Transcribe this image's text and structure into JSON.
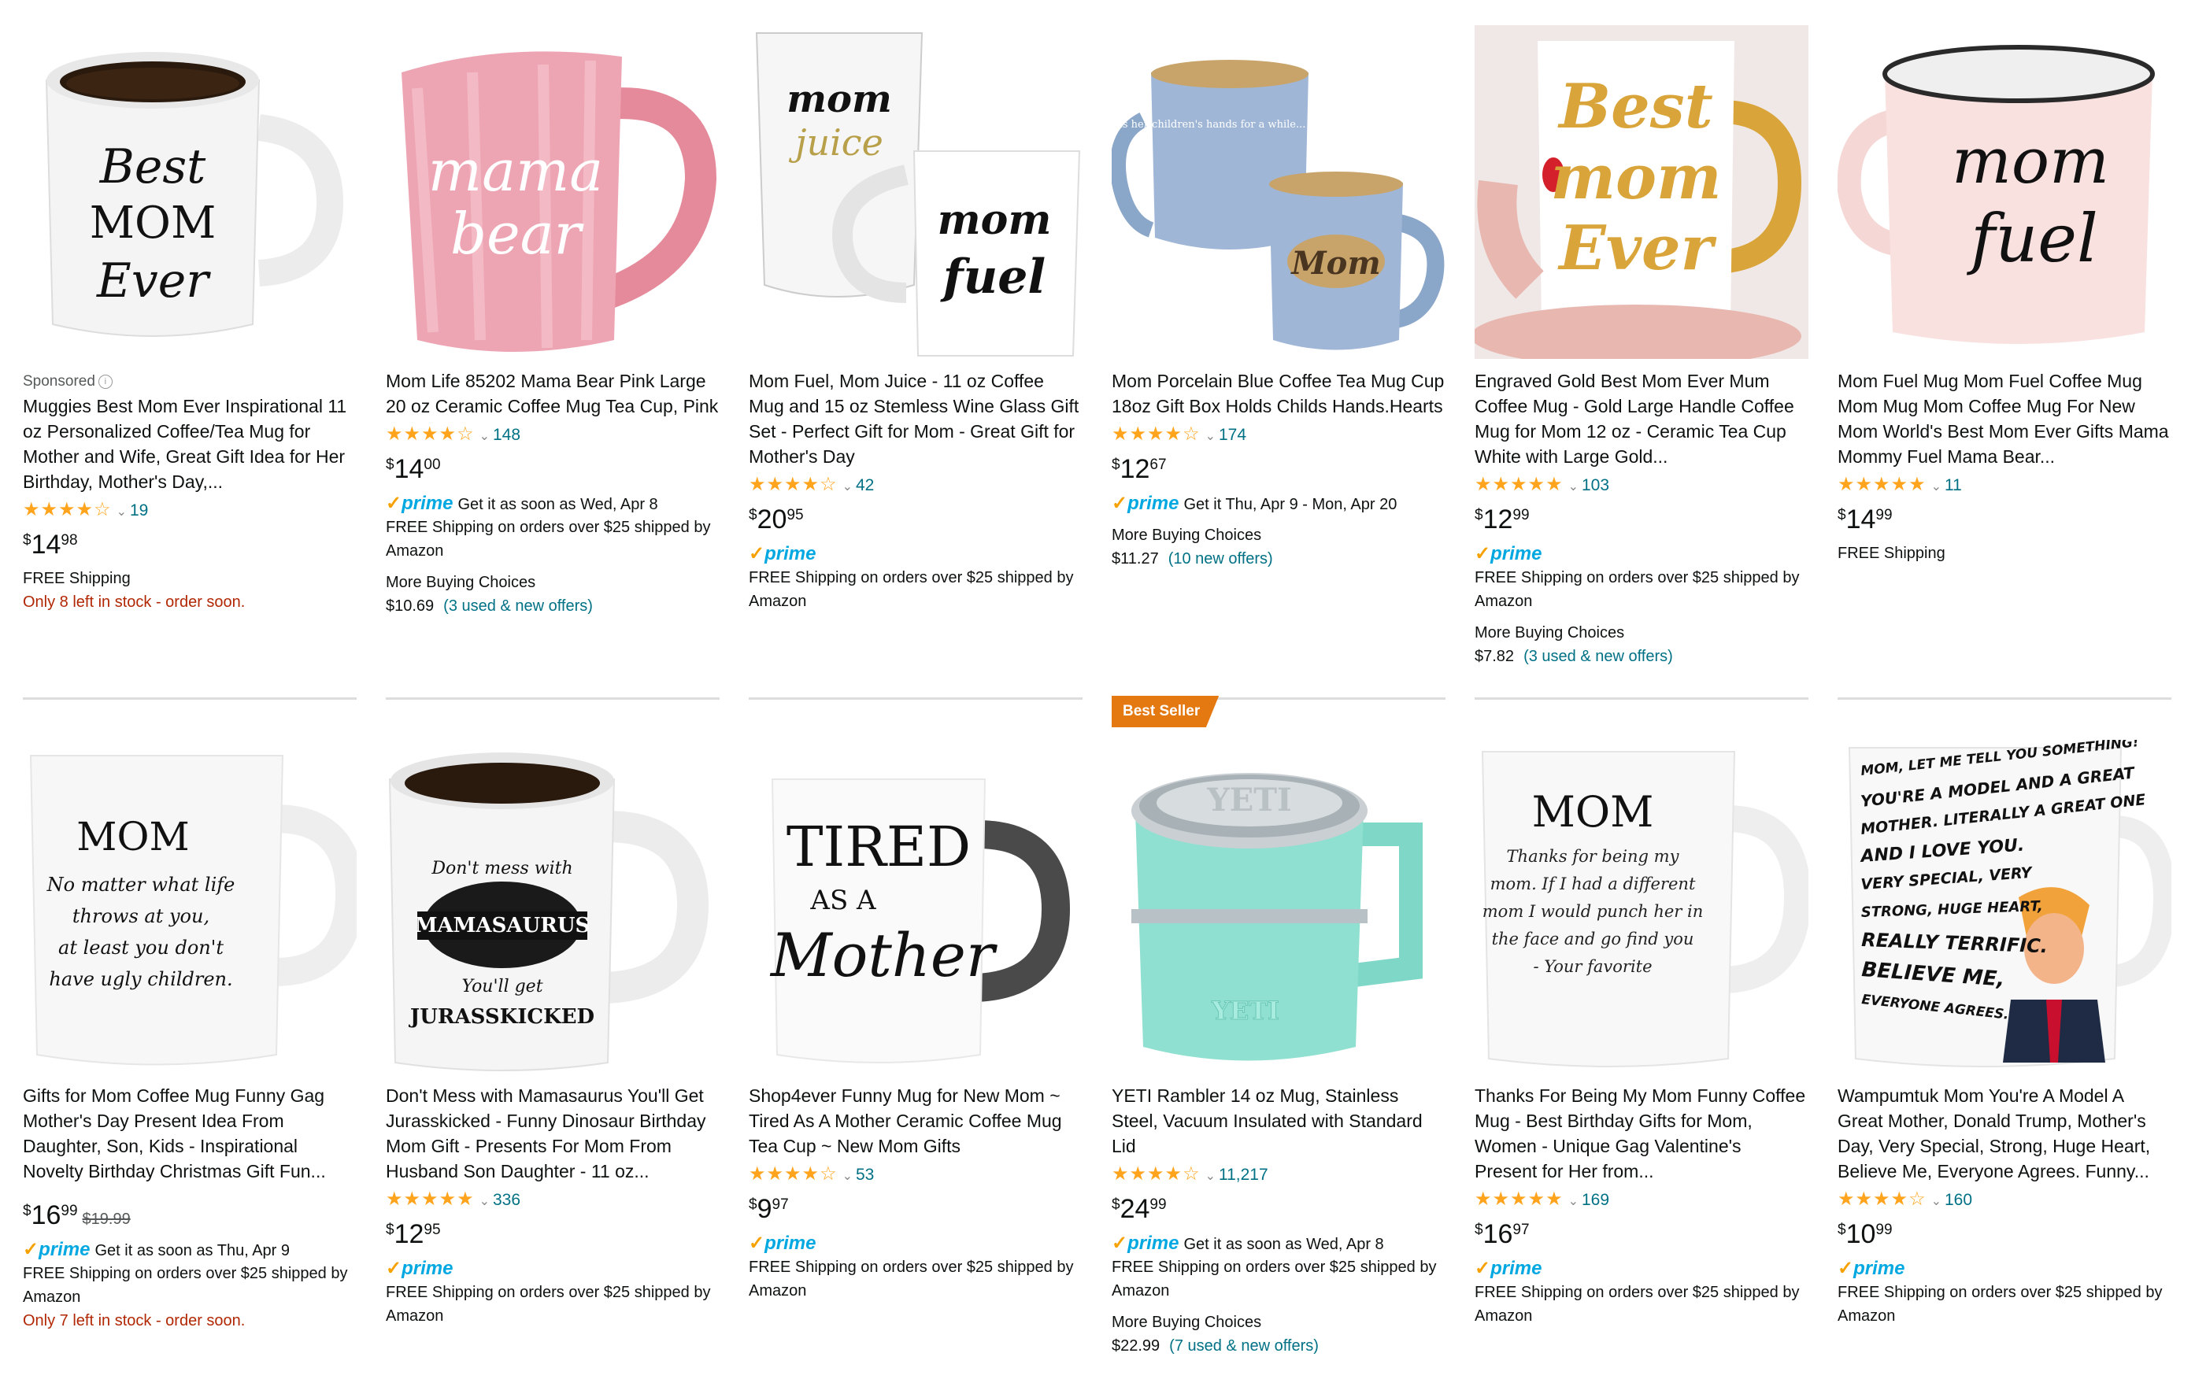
{
  "products": [
    {
      "sponsored": true,
      "sponsored_label": "Sponsored",
      "title": "Muggies Best Mom Ever Inspirational 11 oz Personalized Coffee/Tea Mug for Mother and Wife, Great Gift Idea for Her Birthday, Mother's Day,...",
      "stars_text": "★★★★☆",
      "rating_count": "19",
      "price_symbol": "$",
      "price_whole": "14",
      "price_fraction": "98",
      "shipping": "FREE Shipping",
      "stock": "Only 8 left in stock - order soon.",
      "mug_text": [
        "Best",
        "MOM",
        "Ever"
      ]
    },
    {
      "title": "Mom Life 85202 Mama Bear Pink Large 20 oz Ceramic Coffee Mug Tea Cup, Pink",
      "stars_text": "★★★★☆",
      "rating_count": "148",
      "price_symbol": "$",
      "price_whole": "14",
      "price_fraction": "00",
      "prime_label": "prime",
      "prime_delivery": "Get it as soon as Wed, Apr 8",
      "shipping": "FREE Shipping on orders over $25 shipped by Amazon",
      "more_buying": "More Buying Choices",
      "more_price": "$10.69",
      "more_offers": "(3 used & new offers)",
      "mug_text": [
        "mama",
        "bear"
      ]
    },
    {
      "title": "Mom Fuel, Mom Juice - 11 oz Coffee Mug and 15 oz Stemless Wine Glass Gift Set - Perfect Gift for Mom - Great Gift for Mother's Day",
      "stars_text": "★★★★☆",
      "rating_count": "42",
      "price_symbol": "$",
      "price_whole": "20",
      "price_fraction": "95",
      "prime_label": "prime",
      "shipping": "FREE Shipping on orders over $25 shipped by Amazon",
      "mug_text": [
        "mom",
        "juice",
        "mom",
        "fuel"
      ]
    },
    {
      "title": "Mom Porcelain Blue Coffee Tea Mug Cup 18oz Gift Box Holds Childs Hands.Hearts",
      "stars_text": "★★★★☆",
      "rating_count": "174",
      "price_symbol": "$",
      "price_whole": "12",
      "price_fraction": "67",
      "prime_label": "prime",
      "prime_delivery": "Get it Thu, Apr 9 - Mon, Apr 20",
      "more_buying": "More Buying Choices",
      "more_price": "$11.27",
      "more_offers": "(10 new offers)",
      "mug_text": [
        "A mother holds her children's hands for a while... their hearts forever",
        "Mom"
      ]
    },
    {
      "title": "Engraved Gold Best Mom Ever Mum Coffee Mug - Gold Large Handle Coffee Mug for Mom 12 oz - Ceramic Tea Cup White with Large Gold...",
      "stars_text": "★★★★★",
      "rating_count": "103",
      "price_symbol": "$",
      "price_whole": "12",
      "price_fraction": "99",
      "prime_label": "prime",
      "shipping": "FREE Shipping on orders over $25 shipped by Amazon",
      "more_buying": "More Buying Choices",
      "more_price": "$7.82",
      "more_offers": "(3 used & new offers)",
      "mug_text": [
        "Best",
        "mom",
        "Ever"
      ]
    },
    {
      "title": "Mom Fuel Mug Mom Fuel Coffee Mug Mom Mug Mom Coffee Mug For New Mom World's Best Mom Ever Gifts Mama Mommy Fuel Mama Bear...",
      "stars_text": "★★★★★",
      "rating_count": "11",
      "price_symbol": "$",
      "price_whole": "14",
      "price_fraction": "99",
      "shipping": "FREE Shipping",
      "mug_text": [
        "mom",
        "fuel"
      ]
    },
    {
      "title": "Gifts for Mom Coffee Mug Funny Gag Mother's Day Present Idea From Daughter, Son, Kids - Inspirational Novelty Birthday Christmas Gift Fun...",
      "price_symbol": "$",
      "price_whole": "16",
      "price_fraction": "99",
      "list_price": "$19.99",
      "prime_label": "prime",
      "prime_delivery": "Get it as soon as Thu, Apr 9",
      "shipping": "FREE Shipping on orders over $25 shipped by Amazon",
      "stock": "Only 7 left in stock - order soon.",
      "mug_text": [
        "MOM",
        "No matter what life",
        "throws at you,",
        "at least you don't",
        "have ugly children."
      ]
    },
    {
      "title": "Don't Mess with Mamasaurus You'll Get Jurasskicked - Funny Dinosaur Birthday Mom Gift - Presents For Mom From Husband Son Daughter - 11 oz...",
      "stars_text": "★★★★★",
      "rating_count": "336",
      "price_symbol": "$",
      "price_whole": "12",
      "price_fraction": "95",
      "prime_label": "prime",
      "shipping": "FREE Shipping on orders over $25 shipped by Amazon",
      "mug_text": [
        "Don't mess with",
        "MAMASAURUS",
        "You'll get",
        "JURASSKICKED"
      ]
    },
    {
      "title": "Shop4ever Funny Mug for New Mom ~ Tired As A Mother Ceramic Coffee Mug Tea Cup ~ New Mom Gifts",
      "stars_text": "★★★★☆",
      "rating_count": "53",
      "price_symbol": "$",
      "price_whole": "9",
      "price_fraction": "97",
      "prime_label": "prime",
      "shipping": "FREE Shipping on orders over $25 shipped by Amazon",
      "mug_text": [
        "TIRED",
        "AS A",
        "Mother"
      ]
    },
    {
      "badge": "Best Seller",
      "title": "YETI Rambler 14 oz Mug, Stainless Steel, Vacuum Insulated with Standard Lid",
      "stars_text": "★★★★☆",
      "rating_count": "11,217",
      "price_symbol": "$",
      "price_whole": "24",
      "price_fraction": "99",
      "prime_label": "prime",
      "prime_delivery": "Get it as soon as Wed, Apr 8",
      "shipping": "FREE Shipping on orders over $25 shipped by Amazon",
      "more_buying": "More Buying Choices",
      "more_price": "$22.99",
      "more_offers": "(7 used & new offers)",
      "mug_text": [
        "YETI",
        "YETI"
      ]
    },
    {
      "title": "Thanks For Being My Mom Funny Coffee Mug - Best Birthday Gifts for Mom, Women - Unique Gag Valentine's Present for Her from...",
      "stars_text": "★★★★★",
      "rating_count": "169",
      "price_symbol": "$",
      "price_whole": "16",
      "price_fraction": "97",
      "prime_label": "prime",
      "shipping": "FREE Shipping on orders over $25 shipped by Amazon",
      "mug_text": [
        "MOM",
        "Thanks for being my",
        "mom. If I had a different",
        "mom I would punch her in",
        "the face and go find you",
        "- Your favorite"
      ]
    },
    {
      "title": "Wampumtuk Mom You're A Model A Great Mother, Donald Trump, Mother's Day, Very Special, Strong, Huge Heart, Believe Me, Everyone Agrees. Funny...",
      "stars_text": "★★★★☆",
      "rating_count": "160",
      "price_symbol": "$",
      "price_whole": "10",
      "price_fraction": "99",
      "prime_label": "prime",
      "shipping": "FREE Shipping on orders over $25 shipped by Amazon",
      "mug_text": [
        "MOM, LET ME TELL YOU SOMETHING!",
        "YOU'RE A MODEL AND A GREAT",
        "MOTHER. LITERALLY A GREAT ONE",
        "AND I LOVE YOU.",
        "VERY SPECIAL, VERY",
        "STRONG, HUGE HEART,",
        "REALLY TERRIFIC.",
        "BELIEVE ME,",
        "EVERYONE AGREES."
      ]
    }
  ],
  "colors": {
    "link": "#007185",
    "star": "#FFA41C",
    "stock_warning": "#B12704",
    "prime": "#00A8E1",
    "badge": "#E47911"
  }
}
